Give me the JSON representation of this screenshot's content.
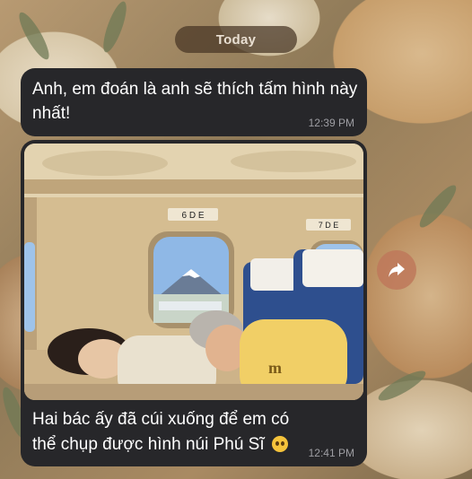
{
  "chat": {
    "date_separator": "Today",
    "messages": [
      {
        "text": "Anh, em đoán là anh sẽ thích tấm hình này nhất!",
        "time": "12:39 PM"
      },
      {
        "photo": {
          "signs": [
            "6 D E",
            "7 D E"
          ]
        },
        "text": "Hai bác ấy đã cúi xuống để em có thể chụp được hình núi Phú Sĩ",
        "emoji": "pleading-face",
        "time": "12:41 PM"
      }
    ],
    "forward_icon": "share-arrow-icon"
  }
}
